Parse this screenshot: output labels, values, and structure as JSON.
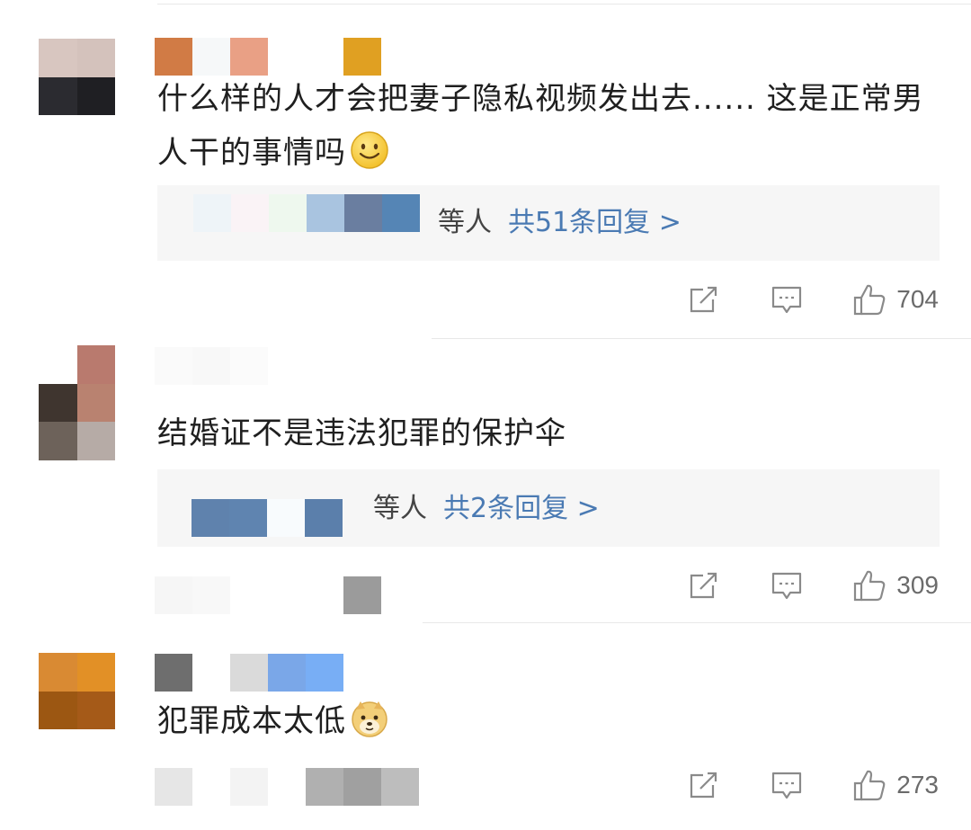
{
  "colors": {
    "link": "#4a7ab3",
    "text": "#1f1f1f",
    "muted": "#6b6b6b",
    "reply_bg": "#f6f6f6"
  },
  "comments": [
    {
      "text": "什么样的人才会把妻子隐私视频发出去...... 这是正常男人干的事情吗",
      "emoji": "smile-emoji",
      "reply_who": "等人",
      "reply_count": "共51条回复 >",
      "likes": "704"
    },
    {
      "text": "结婚证不是违法犯罪的保护伞",
      "reply_who": "等人",
      "reply_count": "共2条回复 >",
      "likes": "309"
    },
    {
      "text": "犯罪成本太低",
      "emoji": "doge-emoji",
      "likes": "273"
    }
  ],
  "icons": {
    "share": "share-icon",
    "comment": "comment-icon",
    "like": "thumbs-up-icon"
  }
}
